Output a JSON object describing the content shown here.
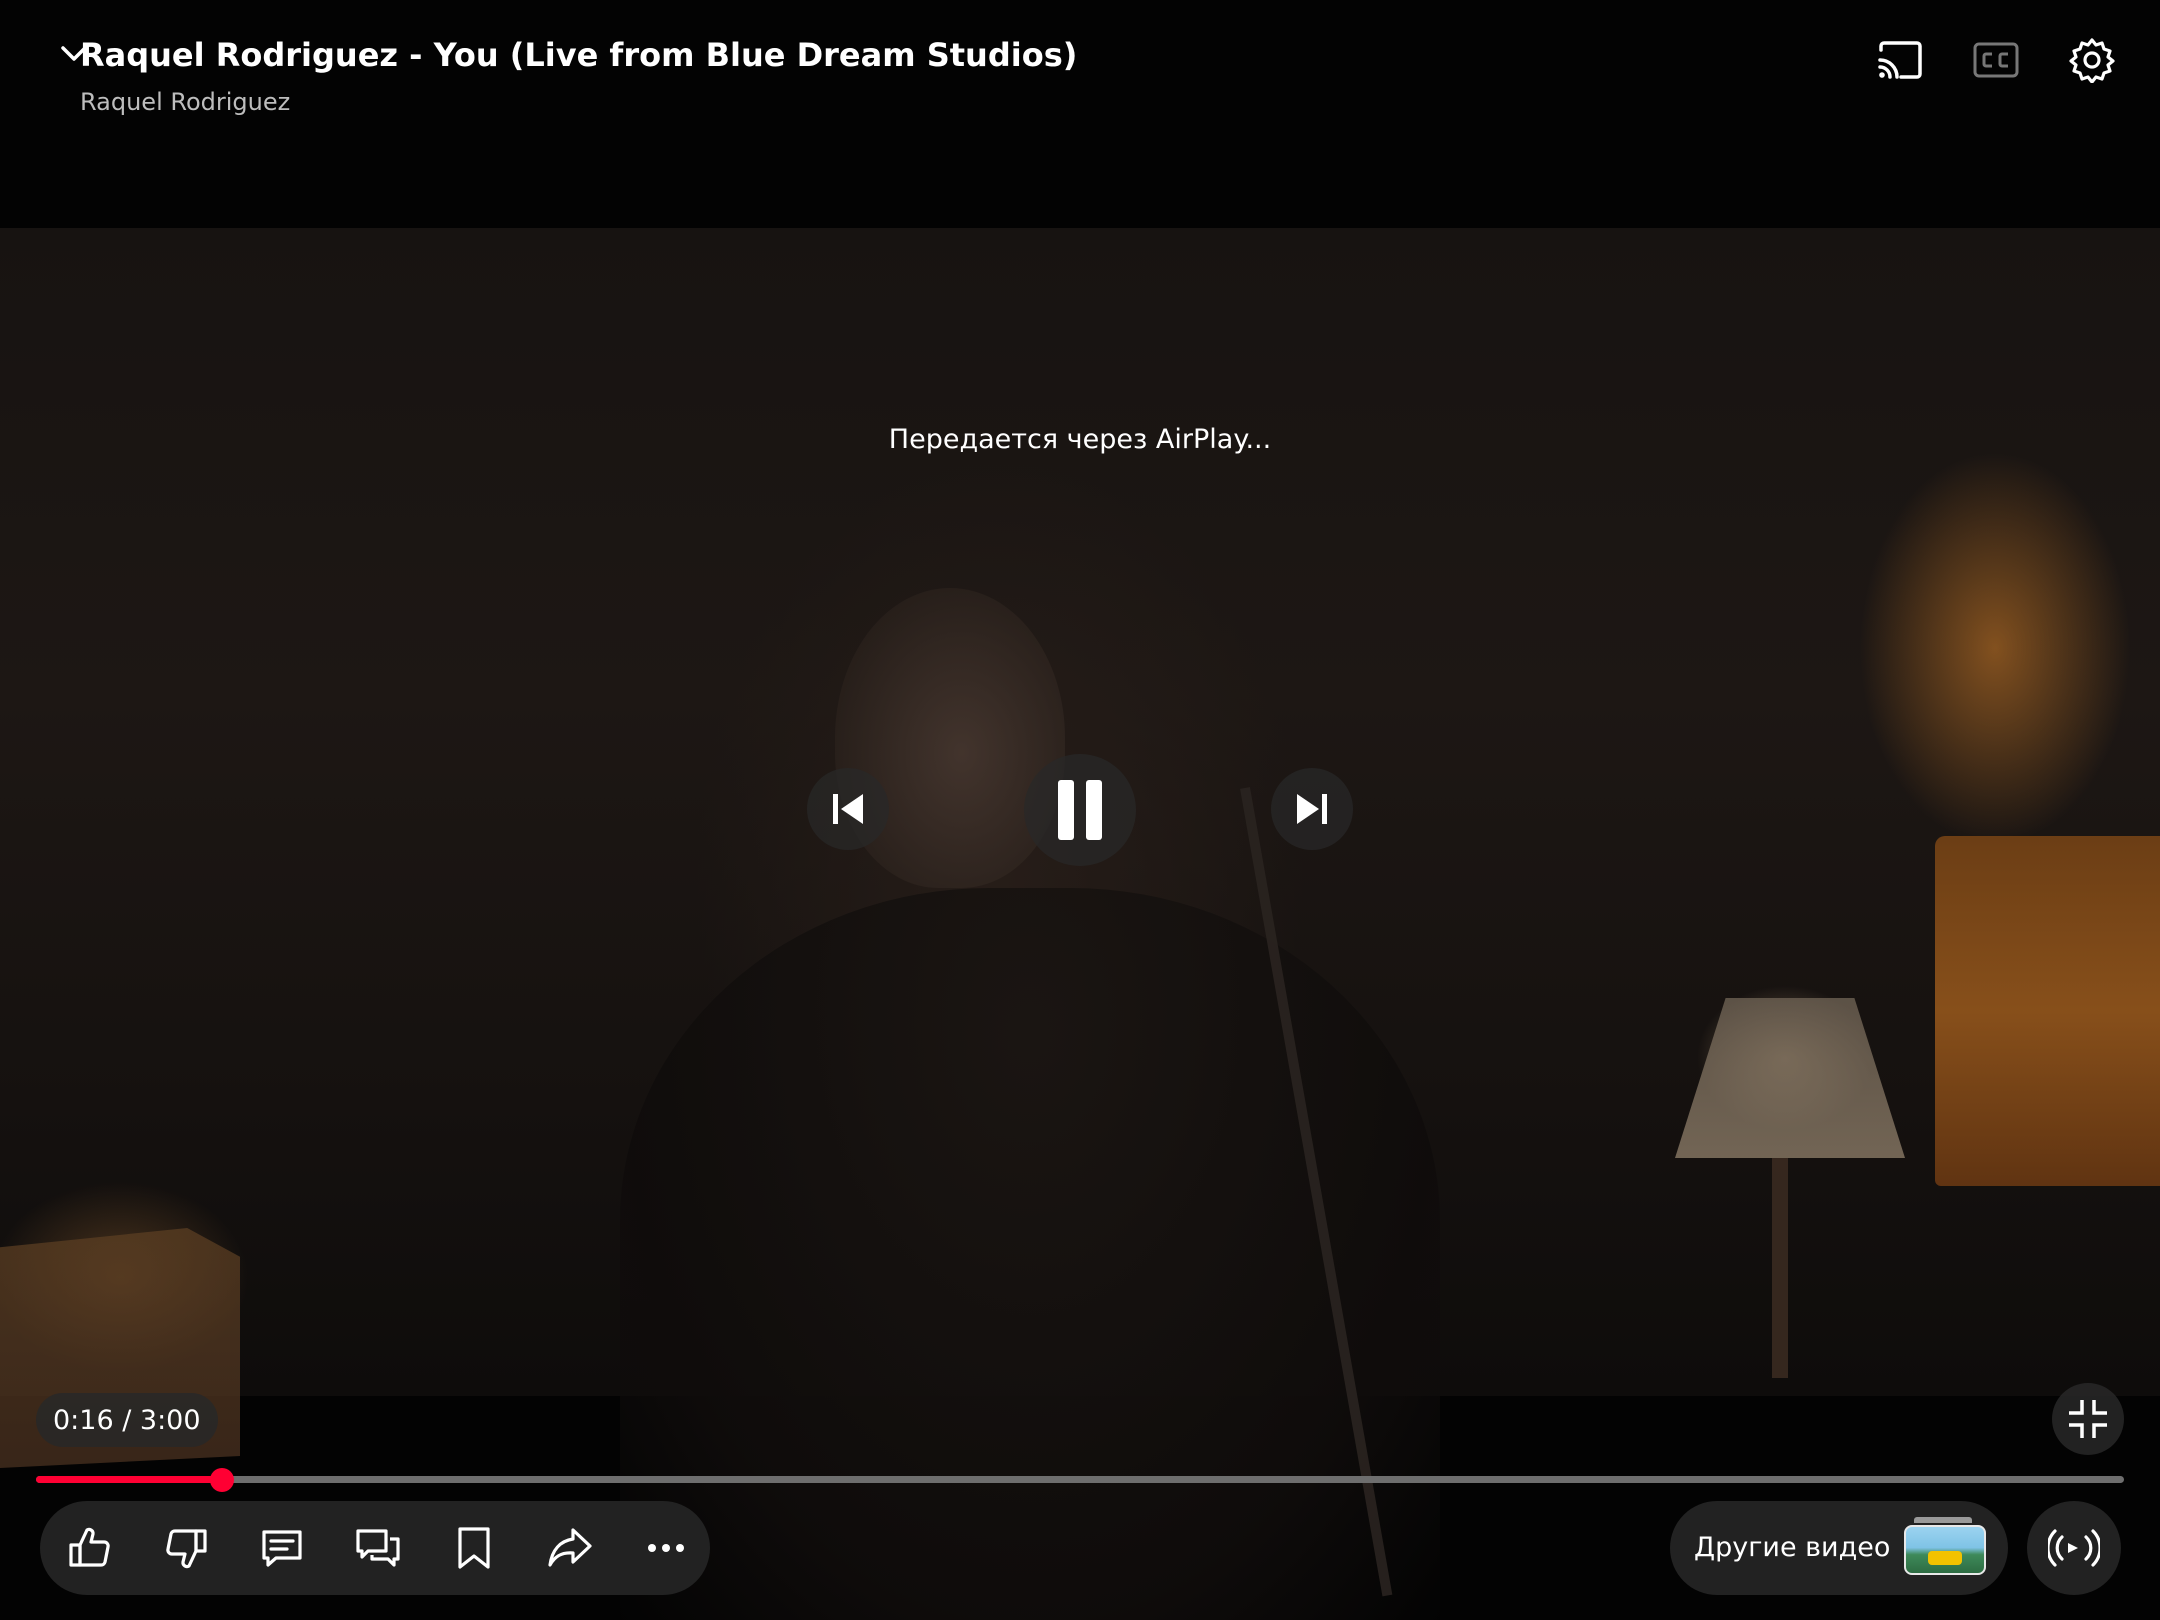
{
  "video": {
    "title": "Raquel Rodriguez - You (Live from Blue Dream Studios)",
    "channel": "Raquel Rodriguez",
    "status": "Передается через AirPlay...",
    "time_display": "0:16 / 3:00",
    "current_time": "0:16",
    "duration": "3:00",
    "progress_fraction": 0.089
  },
  "top_controls": {
    "icons": [
      "chevron-down-icon",
      "cast-icon",
      "captions-icon",
      "settings-icon"
    ]
  },
  "playback_controls": {
    "icons": [
      "previous-icon",
      "pause-icon",
      "next-icon",
      "exit-fullscreen-icon"
    ]
  },
  "action_bar": {
    "icons": [
      "like-icon",
      "dislike-icon",
      "comments-icon",
      "live-chat-icon",
      "save-icon",
      "share-icon",
      "more-icon"
    ]
  },
  "more_videos": {
    "label": "Другие видео"
  },
  "colors": {
    "progress": "#ff0033",
    "track": "#6e6e6e",
    "button_bg": "#222222"
  }
}
